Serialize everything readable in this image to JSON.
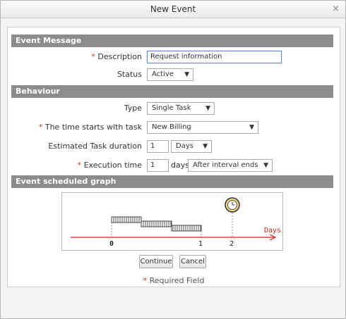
{
  "window": {
    "title": "New Event",
    "close_symbol": "×"
  },
  "sections": {
    "event_message": "Event Message",
    "behaviour": "Behaviour",
    "graph": "Event scheduled graph"
  },
  "required_mark": "*",
  "description": {
    "label": "Description",
    "value": "Request information"
  },
  "status": {
    "label": "Status",
    "value": "Active"
  },
  "type": {
    "label": "Type",
    "value": "Single Task"
  },
  "start_task": {
    "label": "The time starts with task",
    "value": "New Billing"
  },
  "duration": {
    "label": "Estimated Task duration",
    "value": "1",
    "unit": "Days"
  },
  "execution": {
    "label": "Execution time",
    "value": "1",
    "unit_text": "days",
    "mode": "After interval ends"
  },
  "graph": {
    "axis_label": "Days",
    "ticks": [
      "0",
      "1",
      "2"
    ],
    "accent": "#cc2222"
  },
  "buttons": {
    "continue": "Continue",
    "cancel": "Cancel"
  },
  "footer": {
    "required_text": "Required Field"
  },
  "icons": {
    "dropdown": "▼",
    "clock": "clock-icon"
  }
}
